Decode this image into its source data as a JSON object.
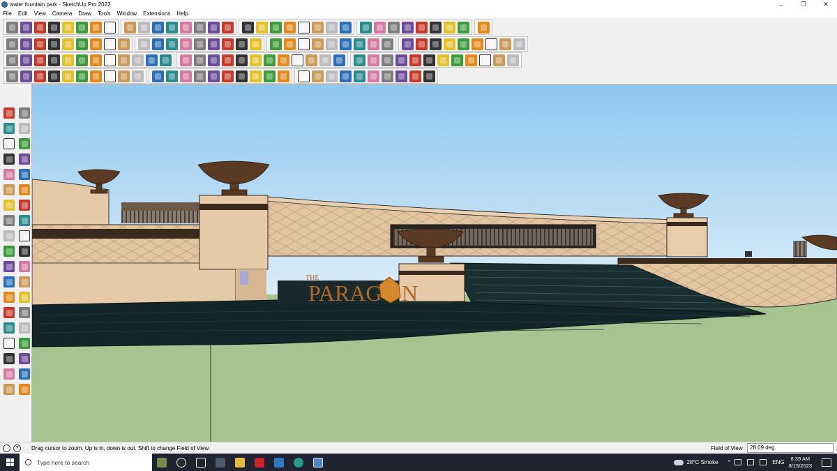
{
  "window": {
    "title": "water fountain park - SketchUp Pro 2022",
    "minimize_glyph": "–",
    "maximize_glyph": "❐",
    "close_glyph": "✕"
  },
  "menu": {
    "items": [
      "File",
      "Edit",
      "View",
      "Camera",
      "Draw",
      "Tools",
      "Window",
      "Extensions",
      "Help"
    ]
  },
  "toolbars": {
    "row1_icons": [
      "zoom-extents",
      "select",
      "eraser",
      "pencil",
      "arc",
      "rectangle",
      "push-pull",
      "move",
      "rotate",
      "scale",
      "offset",
      "tape",
      "text",
      "paint",
      "orbit",
      "pan",
      "zoom",
      "zoom-window",
      "previous",
      "next",
      "section-plane",
      "section-cut",
      "components",
      "warehouse",
      "extensions",
      "layout",
      "style",
      "shadow",
      "fog",
      "match-photo",
      "undo",
      "redo",
      "sandbox"
    ],
    "row2_icons": [
      "iso",
      "top",
      "front",
      "right",
      "back",
      "left",
      "bottom",
      "xray",
      "back-edges",
      "wireframe",
      "hidden-line",
      "shaded",
      "shaded-textures",
      "monochrome",
      "outer-shell",
      "intersect",
      "union",
      "subtract",
      "trim",
      "split",
      "follow-me",
      "solid-tools",
      "soften",
      "paint-tools",
      "add-location",
      "terrain",
      "dynamic-component",
      "solar-north",
      "photo-textures",
      "match-photo",
      "section-fill",
      "tag",
      "hide",
      "unhide",
      "reverse-faces",
      "orient-faces"
    ],
    "row3_icons": [
      "sandbox-contours",
      "sandbox-scratch",
      "smoove",
      "stamp",
      "drape",
      "add-detail",
      "flip-edge",
      "bezier",
      "spline",
      "weld",
      "curviloft",
      "round-corner",
      "fillet",
      "chamfer",
      "cleanup",
      "joint-push-pull",
      "extrude",
      "loft",
      "skin",
      "vertex",
      "soap-bubble",
      "offset-tool",
      "shape-bender",
      "flowify",
      "truebend",
      "profile-builder",
      "material-replacer",
      "purge",
      "window",
      "selection-toys",
      "quadface",
      "subd",
      "artisan",
      "box-stretch",
      "random",
      "array"
    ],
    "row4_icons": [
      "line-tool",
      "freehand",
      "polygon",
      "circle",
      "arc-2pt",
      "pie",
      "extrude-edges",
      "extrude-lines",
      "extrude-face",
      "1001-bit",
      "sweep",
      "roof",
      "stairs",
      "wall",
      "opening",
      "profile",
      "railing",
      "grid",
      "fence",
      "dimension",
      "label",
      "angle",
      "protractor",
      "axes",
      "guide",
      "measure",
      "scale-tool",
      "texture",
      "uv",
      "projection"
    ],
    "left_icons": [
      "select-arrow",
      "orbit-tool",
      "paint-bucket",
      "eraser-tool",
      "component-tool",
      "tape-measure",
      "pencil-line",
      "freehand-curve",
      "rectangle-tool",
      "rotated-rect",
      "circle-tool",
      "polygon-tool",
      "arc-tool",
      "pie-tool",
      "offset-tool",
      "follow-me-tool",
      "move-tool",
      "rotate-tool",
      "scale-tool",
      "push-pull-tool",
      "tape-tool",
      "text-tool",
      "axes-tool",
      "dimension-tool",
      "orbit-tool-2",
      "pan-tool",
      "zoom-tool",
      "zoom-window-tool",
      "zoom-extents-tool",
      "previous-view",
      "position-camera",
      "look-around",
      "walk-tool",
      "section-plane-tool",
      "3d-text",
      "sandbox-tool",
      "layers-tool",
      "outliner-tool"
    ]
  },
  "viewport": {
    "logo_prefix": "THE",
    "logo_word_a": "PARAG",
    "logo_word_b": "N",
    "sky_top": "#8ec7f0",
    "sky_bottom": "#dcedf8",
    "ground": "#a5c48f",
    "water": "#13272a",
    "stone": "#e6c9a6",
    "bronze": "#5a3a22",
    "logo_color": "#b0672a"
  },
  "statusbar": {
    "info_glyph": "?",
    "message": "Drag cursor to zoom.  Up is in, down is out. Shift to change Field of View.",
    "vcb_label": "Field of View",
    "vcb_value": "28.09 deg."
  },
  "taskbar": {
    "search_placeholder": "Type here to search",
    "weather": "28°C  Smoke",
    "tray_caret": "^",
    "language": "ENG",
    "time": "8:39 AM",
    "date": "8/15/2023"
  }
}
